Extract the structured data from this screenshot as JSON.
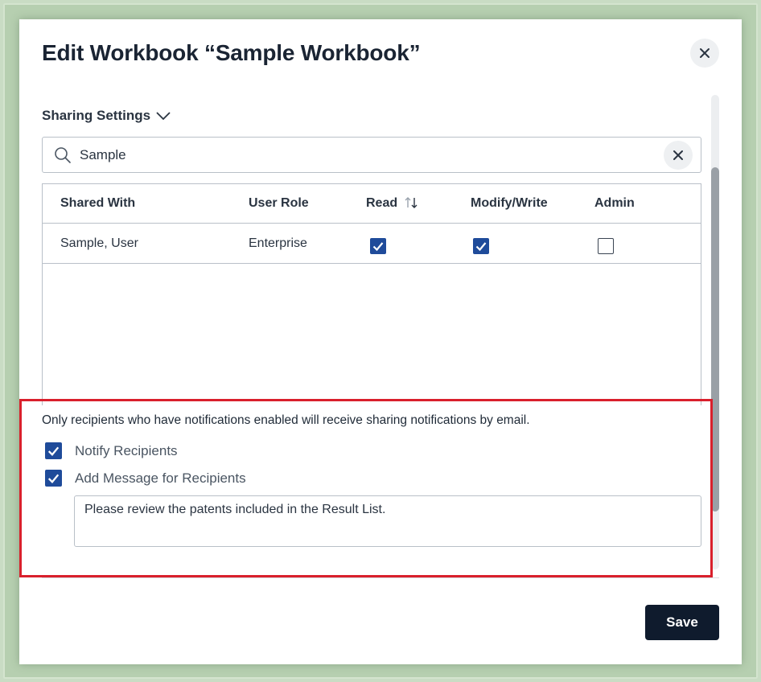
{
  "modal": {
    "title": "Edit Workbook “Sample Workbook”"
  },
  "sharing": {
    "section_label": "Sharing Settings",
    "search": {
      "value": "Sample"
    },
    "table": {
      "headers": {
        "shared_with": "Shared With",
        "user_role": "User Role",
        "read": "Read",
        "modify_write": "Modify/Write",
        "admin": "Admin"
      },
      "rows": [
        {
          "shared_with": "Sample, User",
          "user_role": "Enterprise",
          "read": true,
          "modify_write": true,
          "admin": false
        }
      ]
    }
  },
  "notifications": {
    "notice": "Only recipients who have notifications enabled will receive sharing notifications by email.",
    "notify_label": "Notify Recipients",
    "notify_checked": true,
    "add_message_label": "Add Message for Recipients",
    "add_message_checked": true,
    "message": "Please review the patents included in the Result List."
  },
  "footer": {
    "save_label": "Save"
  },
  "colors": {
    "accent": "#1f4b9a",
    "primary_button": "#0f1b2d",
    "highlight_border": "#d9202c"
  }
}
